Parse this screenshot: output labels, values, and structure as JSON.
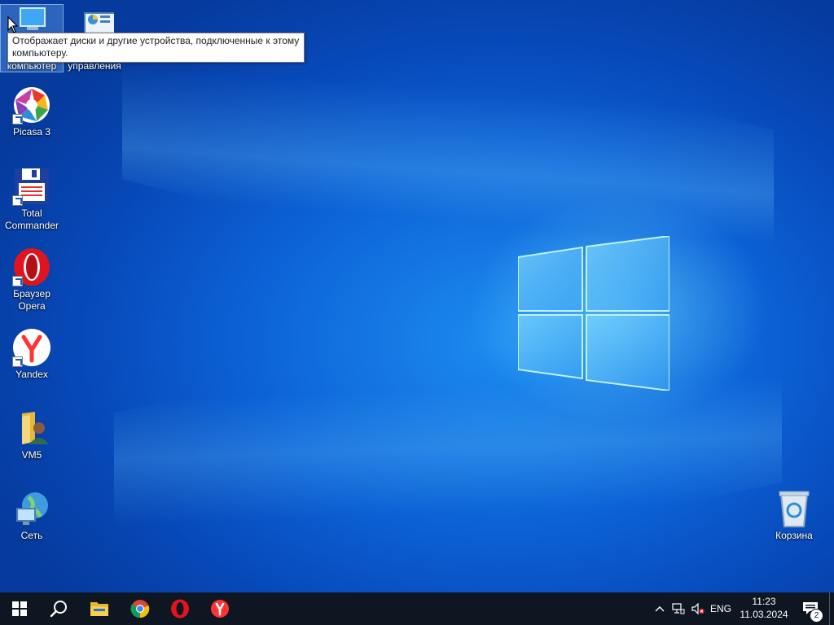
{
  "desktop": {
    "icons": [
      {
        "label": "компьютер",
        "icon": "computer-icon"
      },
      {
        "label": "управления",
        "icon": "control-panel-icon"
      },
      {
        "label": "Picasa 3",
        "icon": "picasa-icon"
      },
      {
        "label": "Total Commander",
        "icon": "total-commander-icon"
      },
      {
        "label": "Браузер Opera",
        "icon": "opera-icon"
      },
      {
        "label": "Yandex",
        "icon": "yandex-icon"
      },
      {
        "label": "VM5",
        "icon": "user-folder-icon"
      },
      {
        "label": "Сеть",
        "icon": "network-globe-icon"
      },
      {
        "label": "Корзина",
        "icon": "recycle-bin-icon"
      }
    ],
    "tooltip": "Отображает диски и другие устройства, подключенные к этому компьютеру."
  },
  "taskbar": {
    "pinned": [
      "windows-start-icon",
      "search-icon",
      "file-explorer-icon",
      "chrome-icon",
      "opera-icon",
      "yandex-browser-icon"
    ],
    "tray": {
      "language": "ENG",
      "time": "11:23",
      "date": "11.03.2024",
      "notification_count": "2"
    }
  },
  "colors": {
    "taskbar_bg": "#0e1622",
    "desktop_accent": "#0c62d6"
  }
}
